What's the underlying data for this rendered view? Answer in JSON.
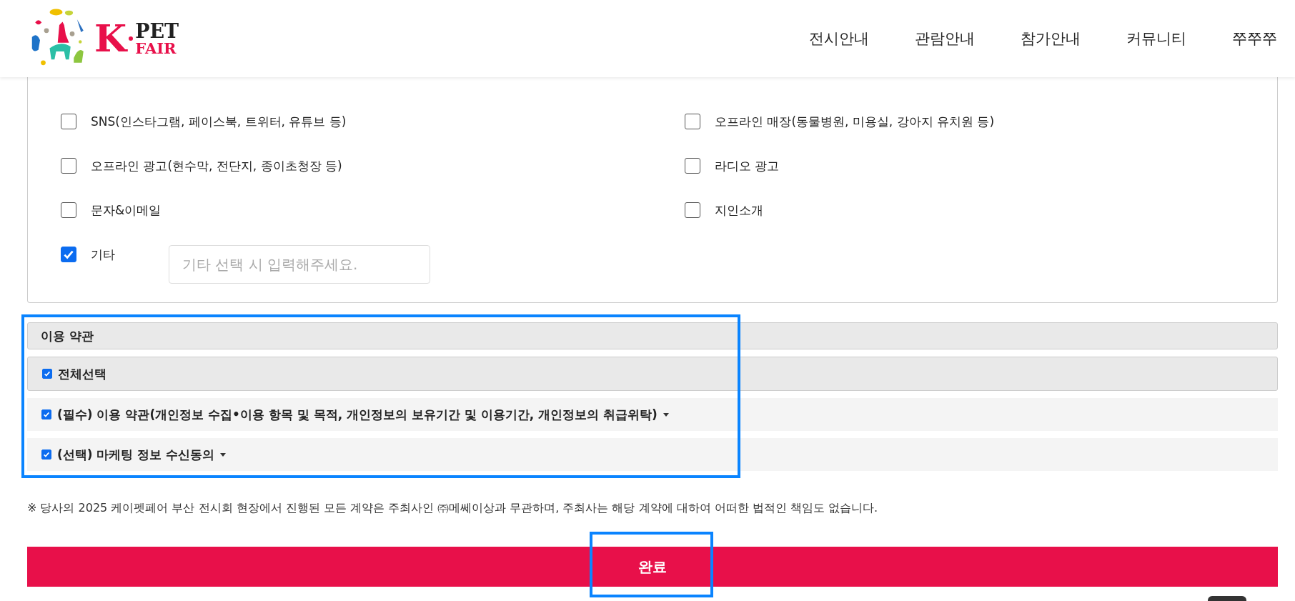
{
  "header": {
    "logo": {
      "mark": "K",
      "word_top": "PET",
      "word_bottom": "FAIR"
    },
    "nav": [
      "전시안내",
      "관람안내",
      "참가안내",
      "커뮤니티",
      "쭈쭈쭈"
    ]
  },
  "survey": {
    "options": [
      {
        "label": "SNS(인스타그램, 페이스북, 트위터, 유튜브 등)",
        "checked": false
      },
      {
        "label": "오프라인 매장(동물병원, 미용실, 강아지 유치원 등)",
        "checked": false
      },
      {
        "label": "오프라인 광고(현수막, 전단지, 종이초청장 등)",
        "checked": false
      },
      {
        "label": "라디오 광고",
        "checked": false
      },
      {
        "label": "문자&이메일",
        "checked": false
      },
      {
        "label": "지인소개",
        "checked": false
      },
      {
        "label": "기타",
        "checked": true,
        "other_field": {
          "placeholder": "기타 선택 시 입력해주세요."
        }
      }
    ]
  },
  "terms": {
    "highlighted": true,
    "title": "이용 약관",
    "select_all": {
      "label": "전체선택",
      "checked": true
    },
    "items": [
      {
        "label": "(필수) 이용 약관(개인정보 수집•이용 항목 및 목적, 개인정보의 보유기간 및 이용기간, 개인정보의 취급위탁)",
        "checked": true,
        "expanded": false
      },
      {
        "label": "(선택) 마케팅 정보 수신동의",
        "checked": true,
        "expanded": false
      }
    ]
  },
  "notice": "※ 당사의 2025 케이펫페어 부산 전시회 현장에서 진행된 모든 계약은 주최사인 ㈜메쎄이상과 무관하며, 주최사는 해당 계약에 대하여 어떠한 법적인 책임도 없습니다.",
  "submit_button": {
    "label": "완료",
    "highlighted": true
  }
}
